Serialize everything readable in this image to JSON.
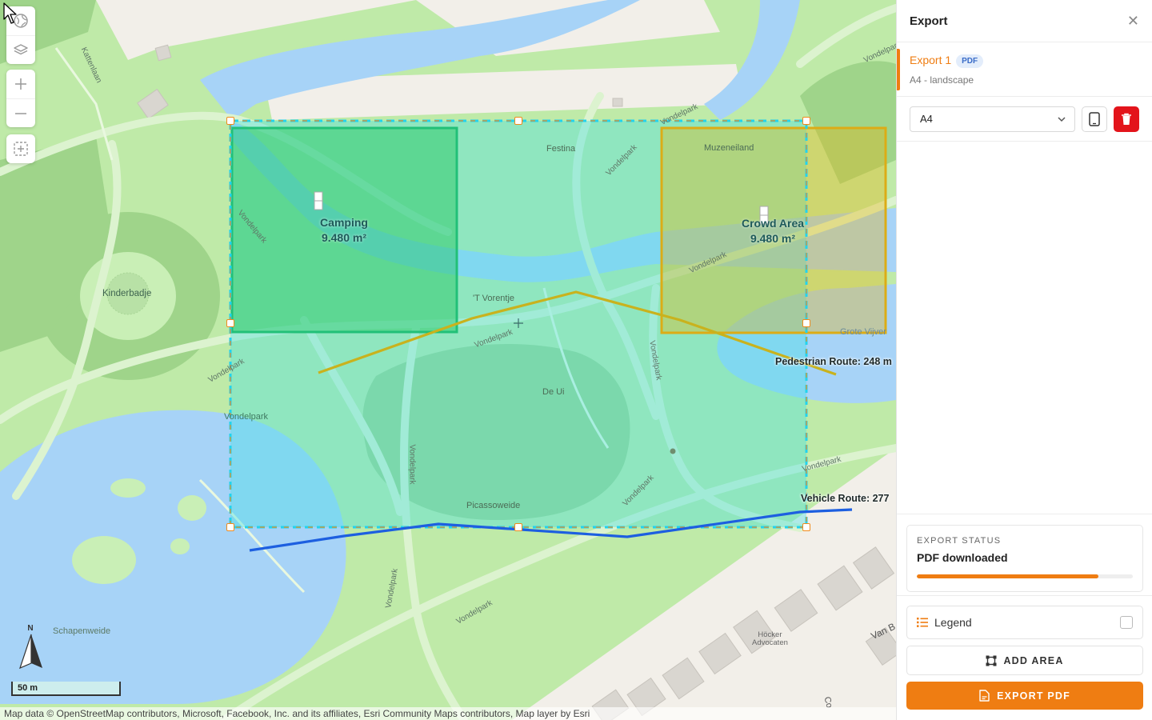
{
  "map": {
    "labels": {
      "kattenlaan": "Kattenlaan",
      "kinderbadje": "Kinderbadje",
      "vondelpark_1": "Vondelpark",
      "vondelpark_2": "Vondelpark",
      "vondelpark_3": "Vondelpark",
      "vondelpark_4": "Vondelpark",
      "vondelpark_5": "Vondelpark",
      "vondelpark_6": "Vondelpark",
      "vondelpark_7": "Vondelpark",
      "vondelpark_8": "Vondelpark",
      "vondelpark_9": "Vondelpark",
      "vondelpark_10": "Vondelpark",
      "vondelpark_11": "Vondelpark",
      "vondelpark_12": "Vondelpark",
      "vondelpark_13": "Vondelpark",
      "vondelpark_14": "Vondelpark",
      "festina": "Festina",
      "muzeneiland": "Muzeneiland",
      "t_vorentje": "'T Vorentje",
      "de_ui": "De Ui",
      "picassoweide": "Picassoweide",
      "schapenweide": "Schapenweide",
      "grote_vijver": "Grote Vijver",
      "hocker": "Höcker\nAdvocaten",
      "van": "Van B",
      "co": "Co"
    },
    "areas": [
      {
        "name": "Camping",
        "size": "9.480 m²"
      },
      {
        "name": "Crowd Area",
        "size": "9.480 m²"
      }
    ],
    "routes": {
      "pedestrian": "Pedestrian Route: 248 m",
      "vehicle": "Vehicle Route: 277"
    },
    "scale_label": "50 m",
    "north_label": "N",
    "attribution": "Map data © OpenStreetMap contributors, Microsoft, Facebook, Inc. and its affiliates, Esri Community Maps contributors, Map layer by Esri",
    "controls": [
      "globe-icon",
      "layers-icon",
      "zoom-in-icon",
      "zoom-out-icon",
      "select-area-icon"
    ],
    "colors": {
      "export_frame": "#22d3ee",
      "frame_handles": "#f08a1c",
      "camping": "#22c55e",
      "crowd_area": "#eab308",
      "pedestrian_route": "#c9b21d",
      "vehicle_route": "#1d5fe0"
    }
  },
  "panel": {
    "title": "Export",
    "export_item": {
      "name": "Export 1",
      "badge": "PDF",
      "subtitle": "A4 - landscape"
    },
    "format": {
      "selected": "A4"
    },
    "status": {
      "heading": "EXPORT STATUS",
      "text": "PDF downloaded",
      "progress": 0.84
    },
    "legend_label": "Legend",
    "legend_checked": false,
    "add_area_label": "ADD AREA",
    "export_pdf_label": "EXPORT PDF",
    "colors": {
      "accent": "#ef7d12",
      "delete": "#e3141b",
      "badge_bg": "#e3edfb",
      "badge_text": "#3a6cc8"
    }
  }
}
